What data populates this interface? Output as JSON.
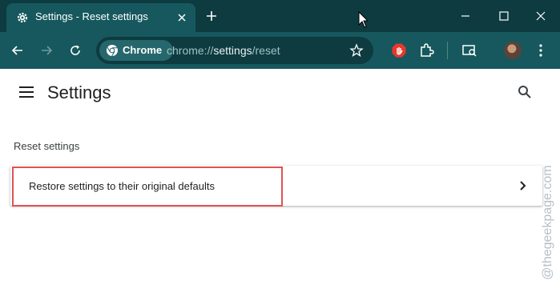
{
  "browser": {
    "tab": {
      "title": "Settings - Reset settings"
    },
    "omnibox": {
      "chip_label": "Chrome",
      "url_scheme": "chrome://",
      "url_host": "settings",
      "url_path": "/reset"
    }
  },
  "settings": {
    "title": "Settings",
    "section_title": "Reset settings",
    "rows": [
      {
        "label": "Restore settings to their original defaults"
      }
    ]
  },
  "watermark": "@thegeekpage.com",
  "colors": {
    "tabstrip": "#0d3b40",
    "toolbar": "#16585d",
    "highlight": "#e05252"
  },
  "icons": [
    "gear-icon",
    "close-icon",
    "plus-icon",
    "minimize-icon",
    "maximize-icon",
    "back-icon",
    "forward-icon",
    "reload-icon",
    "chrome-icon",
    "star-icon",
    "adblock-icon",
    "extensions-icon",
    "cast-search-icon",
    "avatar",
    "kebab-menu-icon",
    "hamburger-icon",
    "search-icon",
    "chevron-right-icon"
  ]
}
